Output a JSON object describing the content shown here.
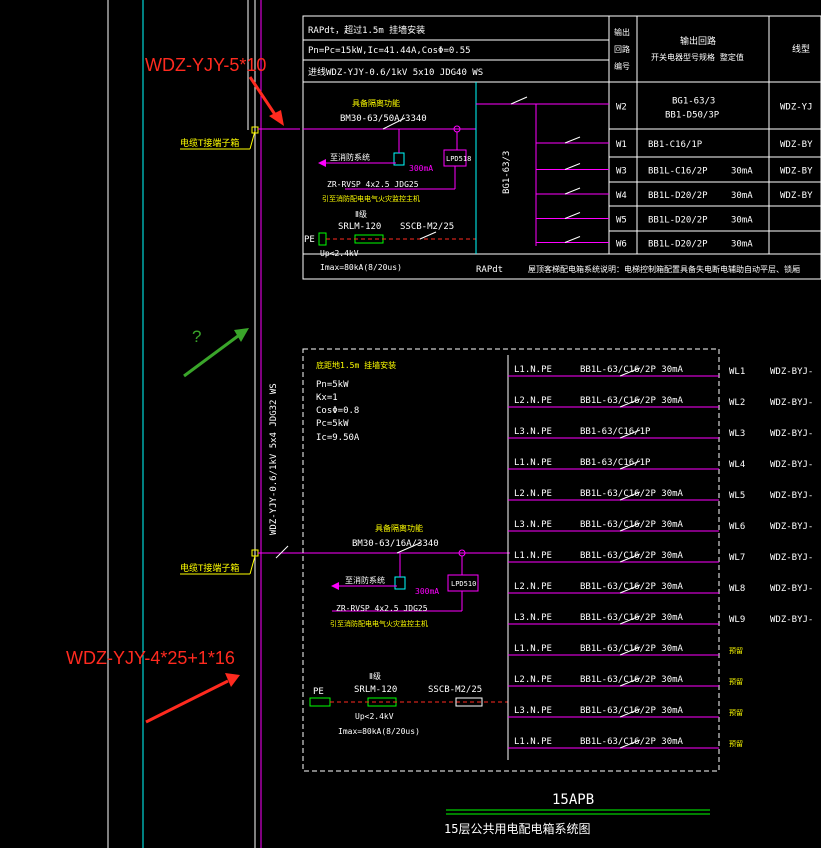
{
  "annotations": {
    "top_cable": "WDZ-YJY-5*10",
    "bottom_cable": "WDZ-YJY-4*25+1*16",
    "question": "?"
  },
  "top_panel": {
    "info_lines": [
      "RAPdt，超过1.5m 挂墙安装",
      "Pn=Pc=15kW,Ic=41.44A,CosΦ=0.55",
      "进线WDZ-YJY-0.6/1kV 5x10 JDG40 WS"
    ],
    "header_loop": [
      "输出",
      "回路",
      "编号"
    ],
    "header_device": "输出回路",
    "header_device_sub": "开关电器型号规格      整定值",
    "header_cable": "线型",
    "main_switch_label": "具备隔离功能",
    "main_switch_model": "BM30-63/50A/3340",
    "fire_signal": "至消防系统",
    "rcd_value": "300mA",
    "ldm": "LPD518",
    "fire_cable": "ZR-RVSP 4x2.5 JDG25",
    "fire_cable_note": "引至消防配电电气火灾监控主机",
    "spd_level": "Ⅱ级",
    "spd_model": "SRLM-120",
    "spd_breaker": "SSCB-M2/25",
    "pe": "PE",
    "up": "Up<2.4kV",
    "imax": "Imax=80kA(8/20us)",
    "bus_label": "BG1-63/3",
    "footer_code": "RAPdt",
    "footer_note": "屋顶客梯配电箱系统说明：电梯控制箱配置具备失电断电辅助自动平层、锁厢",
    "rows": [
      {
        "code": "W2",
        "device": "BG1-63/3",
        "device2": "BB1-D50/3P",
        "value": "",
        "cable": "WDZ-YJ"
      },
      {
        "code": "W1",
        "device": "BB1-C16/1P",
        "value": "",
        "cable": "WDZ-BY"
      },
      {
        "code": "W3",
        "device": "BB1L-C16/2P",
        "value": "30mA",
        "cable": "WDZ-BY"
      },
      {
        "code": "W4",
        "device": "BB1L-D20/2P",
        "value": "30mA",
        "cable": "WDZ-BY"
      },
      {
        "code": "W5",
        "device": "BB1L-D20/2P",
        "value": "30mA",
        "cable": ""
      },
      {
        "code": "W6",
        "device": "BB1L-D20/2P",
        "value": "30mA",
        "cable": ""
      }
    ]
  },
  "bottom_panel": {
    "info_lines": [
      "底距地1.5m 挂墙安装",
      "Pn=5kW",
      "Kx=1",
      "CosΦ=0.8",
      "Pc=5kW",
      "Ic=9.50A"
    ],
    "feeder_vertical": "WDZ-YJY-0.6/1kV 5x4 JDG32 WS",
    "main_switch_label": "具备隔离功能",
    "main_switch_model": "BM30-63/16A/3340",
    "fire_signal": "至消防系统",
    "rcd_value": "300mA",
    "ldm": "LPD510",
    "fire_cable": "ZR-RVSP 4x2.5 JDG25",
    "fire_cable_note": "引至消防配电电气火灾监控主机",
    "spd_level": "Ⅱ级",
    "spd_model": "SRLM-120",
    "spd_breaker": "SSCB-M2/25",
    "pe": "PE",
    "up": "Up<2.4kV",
    "imax": "Imax=80kA(8/20us)",
    "title": "15APB",
    "subtitle": "15层公共用电配电箱系统图",
    "rows": [
      {
        "phase": "L1.N.PE",
        "device": "BB1L-63/C16/2P 30mA",
        "code": "WL1",
        "cable": "WDZ-BYJ-"
      },
      {
        "phase": "L2.N.PE",
        "device": "BB1L-63/C16/2P 30mA",
        "code": "WL2",
        "cable": "WDZ-BYJ-"
      },
      {
        "phase": "L3.N.PE",
        "device": "BB1-63/C16/1P",
        "code": "WL3",
        "cable": "WDZ-BYJ-"
      },
      {
        "phase": "L1.N.PE",
        "device": "BB1-63/C16/1P",
        "code": "WL4",
        "cable": "WDZ-BYJ-"
      },
      {
        "phase": "L2.N.PE",
        "device": "BB1L-63/C16/2P 30mA",
        "code": "WL5",
        "cable": "WDZ-BYJ-"
      },
      {
        "phase": "L3.N.PE",
        "device": "BB1L-63/C16/2P 30mA",
        "code": "WL6",
        "cable": "WDZ-BYJ-"
      },
      {
        "phase": "L1.N.PE",
        "device": "BB1L-63/C16/2P 30mA",
        "code": "WL7",
        "cable": "WDZ-BYJ-"
      },
      {
        "phase": "L2.N.PE",
        "device": "BB1L-63/C16/2P 30mA",
        "code": "WL8",
        "cable": "WDZ-BYJ-"
      },
      {
        "phase": "L3.N.PE",
        "device": "BB1L-63/C16/2P 30mA",
        "code": "WL9",
        "cable": "WDZ-BYJ-"
      },
      {
        "phase": "L1.N.PE",
        "device": "BB1L-63/C16/2P 30mA",
        "code": "预留",
        "cable": ""
      },
      {
        "phase": "L2.N.PE",
        "device": "BB1L-63/C16/2P 30mA",
        "code": "预留",
        "cable": ""
      },
      {
        "phase": "L3.N.PE",
        "device": "BB1L-63/C16/2P 30mA",
        "code": "预留",
        "cable": ""
      },
      {
        "phase": "L1.N.PE",
        "device": "BB1L-63/C16/2P 30mA",
        "code": "预留",
        "cable": ""
      }
    ]
  },
  "riser_labels": {
    "top_tap": "电缆T接端子箱",
    "bottom_tap": "电缆T接端子箱"
  },
  "colors": {
    "background": "#000000",
    "white": "#ffffff",
    "magenta": "#ff00ff",
    "cyan": "#00ffff",
    "yellow": "#ffff00",
    "green": "#00ff00",
    "red": "#ff2a1f",
    "arrow_green": "#3aa52a"
  }
}
